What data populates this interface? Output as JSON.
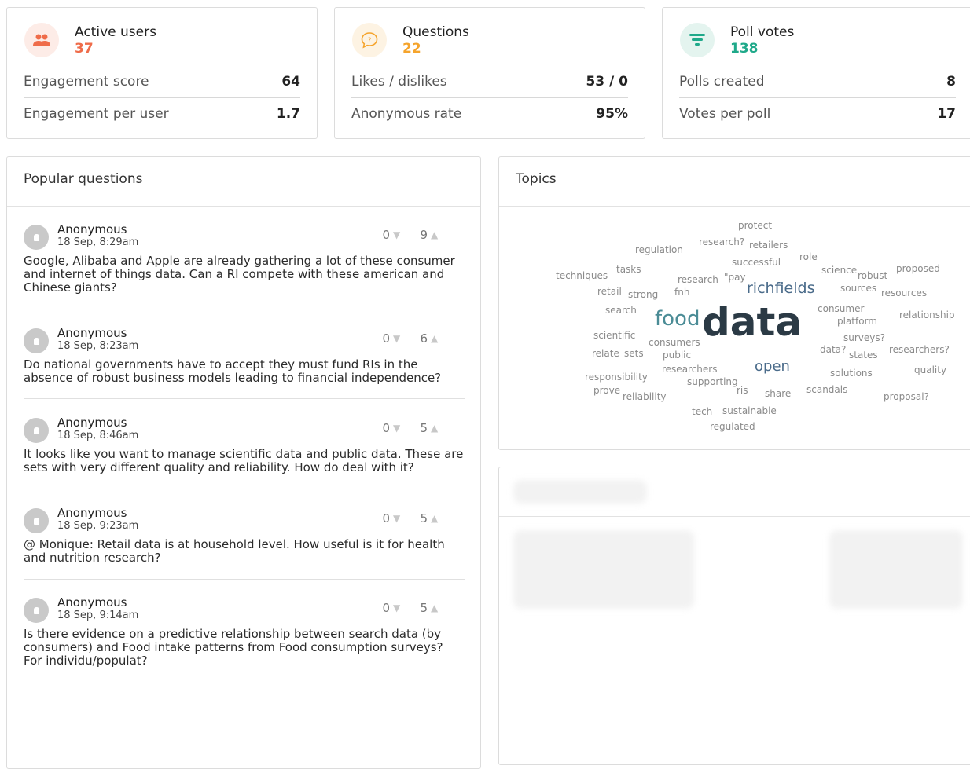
{
  "stats": [
    {
      "title": "Active users",
      "value": "37",
      "value_color": "#ef6c4a",
      "icon": "users-icon",
      "icon_bg": "#fdece7",
      "icon_color": "#ef6c4a",
      "rows": [
        {
          "label": "Engagement score",
          "value": "64"
        },
        {
          "label": "Engagement per user",
          "value": "1.7"
        }
      ]
    },
    {
      "title": "Questions",
      "value": "22",
      "value_color": "#f5a42c",
      "icon": "speech-bubble-question-icon",
      "icon_bg": "#fdf3e3",
      "icon_color": "#f5a42c",
      "rows": [
        {
          "label": "Likes / dislikes",
          "value": "53 / 0"
        },
        {
          "label": "Anonymous rate",
          "value": "95%"
        }
      ]
    },
    {
      "title": "Poll votes",
      "value": "138",
      "value_color": "#1fa98a",
      "icon": "poll-funnel-icon",
      "icon_bg": "#e4f4ef",
      "icon_color": "#1fa98a",
      "rows": [
        {
          "label": "Polls created",
          "value": "8"
        },
        {
          "label": "Votes per poll",
          "value": "17"
        }
      ]
    }
  ],
  "popular": {
    "title": "Popular questions",
    "items": [
      {
        "author": "Anonymous",
        "time": "18 Sep, 8:29am",
        "dislikes": "0",
        "likes": "9",
        "text": "Google, Alibaba and Apple are already gathering a lot of these consumer and internet of things data. Can a RI compete with these american and Chinese giants?"
      },
      {
        "author": "Anonymous",
        "time": "18 Sep, 8:23am",
        "dislikes": "0",
        "likes": "6",
        "text": "Do national governments have to accept they must fund RIs in the absence of robust business models leading to financial independence?"
      },
      {
        "author": "Anonymous",
        "time": "18 Sep, 8:46am",
        "dislikes": "0",
        "likes": "5",
        "text": "It looks like you want to manage scientific data and public data. These are sets with very different quality and reliability. How do deal with it?"
      },
      {
        "author": "Anonymous",
        "time": "18 Sep, 9:23am",
        "dislikes": "0",
        "likes": "5",
        "text": "@ Monique: Retail data is at household level. How useful is it for health and nutrition research?"
      },
      {
        "author": "Anonymous",
        "time": "18 Sep, 9:14am",
        "dislikes": "0",
        "likes": "5",
        "text": "Is there evidence on a predictive relationship between search data (by consumers) and Food intake patterns from Food consumption surveys? For individu/populat?"
      }
    ]
  },
  "topics": {
    "title": "Topics",
    "words": [
      {
        "t": "protect",
        "c": "#8a8a8a"
      },
      {
        "t": "regulation",
        "c": "#8a8a8a"
      },
      {
        "t": "research?",
        "c": "#8a8a8a"
      },
      {
        "t": "retailers",
        "c": "#8a8a8a"
      },
      {
        "t": "role",
        "c": "#8a8a8a"
      },
      {
        "t": "successful",
        "c": "#8a8a8a"
      },
      {
        "t": "techniques",
        "c": "#8a8a8a"
      },
      {
        "t": "tasks",
        "c": "#8a8a8a"
      },
      {
        "t": "science",
        "c": "#8a8a8a"
      },
      {
        "t": "robust",
        "c": "#8a8a8a"
      },
      {
        "t": "proposed",
        "c": "#8a8a8a"
      },
      {
        "t": "research",
        "c": "#8a8a8a"
      },
      {
        "t": "\"pay",
        "c": "#8a8a8a"
      },
      {
        "t": "richfields",
        "c": "#4a6b8a"
      },
      {
        "t": "retail",
        "c": "#8a8a8a"
      },
      {
        "t": "strong",
        "c": "#8a8a8a"
      },
      {
        "t": "fnh",
        "c": "#8a8a8a"
      },
      {
        "t": "sources",
        "c": "#8a8a8a"
      },
      {
        "t": "resources",
        "c": "#8a8a8a"
      },
      {
        "t": "search",
        "c": "#8a8a8a"
      },
      {
        "t": "consumer",
        "c": "#8a8a8a"
      },
      {
        "t": "platform",
        "c": "#8a8a8a"
      },
      {
        "t": "relationship",
        "c": "#8a8a8a"
      },
      {
        "t": "food",
        "c": "#4b8c96"
      },
      {
        "t": "data",
        "c": "#2b3a45"
      },
      {
        "t": "scientific",
        "c": "#8a8a8a"
      },
      {
        "t": "consumers",
        "c": "#8a8a8a"
      },
      {
        "t": "surveys?",
        "c": "#8a8a8a"
      },
      {
        "t": "relate",
        "c": "#8a8a8a"
      },
      {
        "t": "sets",
        "c": "#8a8a8a"
      },
      {
        "t": "public",
        "c": "#8a8a8a"
      },
      {
        "t": "data?",
        "c": "#8a8a8a"
      },
      {
        "t": "states",
        "c": "#8a8a8a"
      },
      {
        "t": "researchers?",
        "c": "#8a8a8a"
      },
      {
        "t": "researchers",
        "c": "#8a8a8a"
      },
      {
        "t": "open",
        "c": "#4a6b8a"
      },
      {
        "t": "responsibility",
        "c": "#8a8a8a"
      },
      {
        "t": "solutions",
        "c": "#8a8a8a"
      },
      {
        "t": "quality",
        "c": "#8a8a8a"
      },
      {
        "t": "supporting",
        "c": "#8a8a8a"
      },
      {
        "t": "prove",
        "c": "#8a8a8a"
      },
      {
        "t": "ris",
        "c": "#8a8a8a"
      },
      {
        "t": "share",
        "c": "#8a8a8a"
      },
      {
        "t": "scandals",
        "c": "#8a8a8a"
      },
      {
        "t": "reliability",
        "c": "#8a8a8a"
      },
      {
        "t": "proposal?",
        "c": "#8a8a8a"
      },
      {
        "t": "tech",
        "c": "#8a8a8a"
      },
      {
        "t": "sustainable",
        "c": "#8a8a8a"
      },
      {
        "t": "regulated",
        "c": "#8a8a8a"
      }
    ]
  }
}
